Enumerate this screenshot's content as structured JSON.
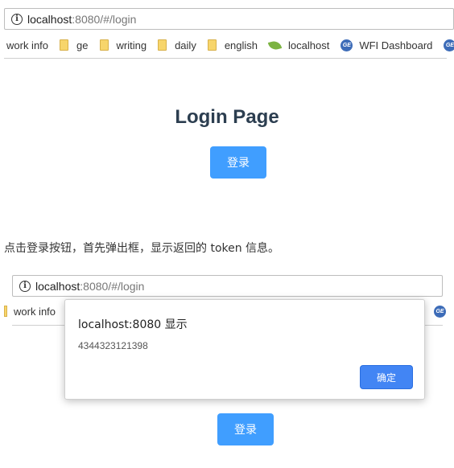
{
  "top_browser": {
    "url_host": "localhost",
    "url_path": ":8080/#/login",
    "bookmarks": [
      {
        "label": "work info",
        "icon": "none"
      },
      {
        "label": "ge",
        "icon": "folder-icon"
      },
      {
        "label": "writing",
        "icon": "folder-icon"
      },
      {
        "label": "daily",
        "icon": "folder-icon"
      },
      {
        "label": "english",
        "icon": "folder-icon"
      },
      {
        "label": "localhost",
        "icon": "leaf-icon"
      },
      {
        "label": "WFI Dashboard",
        "icon": "ge-icon"
      }
    ]
  },
  "page": {
    "title": "Login Page",
    "login_label": "登录"
  },
  "caption": "点击登录按钮，首先弹出框，显示返回的 token 信息。",
  "bottom_browser": {
    "url_host": "localhost",
    "url_path": ":8080/#/login",
    "bookmark_first": "work info"
  },
  "dialog": {
    "title": "localhost:8080 显示",
    "message": "4344323121398",
    "ok_label": "确定"
  },
  "bottom_page": {
    "login_label": "登录"
  },
  "colors": {
    "primary": "#409eff",
    "dialog_ok": "#4285f4",
    "title": "#2c3e50"
  }
}
